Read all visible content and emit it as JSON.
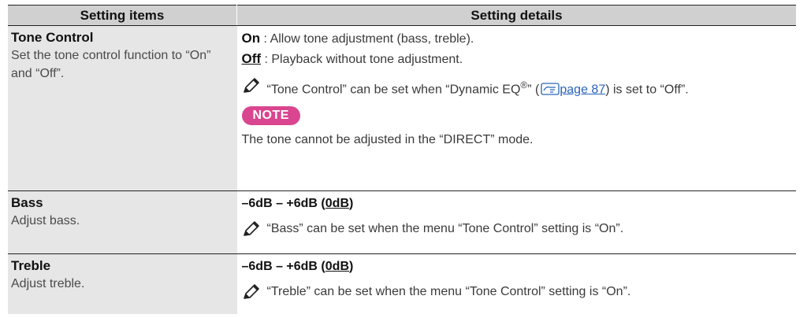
{
  "header": {
    "col1": "Setting items",
    "col2": "Setting details"
  },
  "tone_control": {
    "title": "Tone Control",
    "desc": "Set the tone control function to “On” and “Off”.",
    "on_label": "On",
    "on_text": " : Allow tone adjustment (bass, treble).",
    "off_label": "Off",
    "off_text": " : Playback without tone adjustment.",
    "memo_pre": "“Tone Control” can be set when “Dynamic EQ",
    "memo_reg": "®",
    "memo_mid": "” (",
    "memo_link": "page 87",
    "memo_post": ") is set to “Off”.",
    "note_label": "NOTE",
    "note_text": "The tone cannot be adjusted in the “DIRECT” mode."
  },
  "bass": {
    "title": "Bass",
    "desc": "Adjust bass.",
    "range_pre": "–6dB – +6dB (",
    "range_default": "0dB",
    "range_post": ")",
    "memo": "“Bass” can be set when the menu “Tone Control” setting is “On”."
  },
  "treble": {
    "title": "Treble",
    "desc": "Adjust treble.",
    "range_pre": "–6dB – +6dB (",
    "range_default": "0dB",
    "range_post": ")",
    "memo": "“Treble” can be set when the menu “Tone Control” setting is “On”."
  },
  "icons": {
    "memo": "pencil-icon",
    "reference": "reference-hand-icon"
  },
  "colors": {
    "header_bg": "#d0d0d0",
    "name_cell_bg": "#e6e6e6",
    "note_badge": "#d9468f",
    "link": "#2a63b8"
  }
}
